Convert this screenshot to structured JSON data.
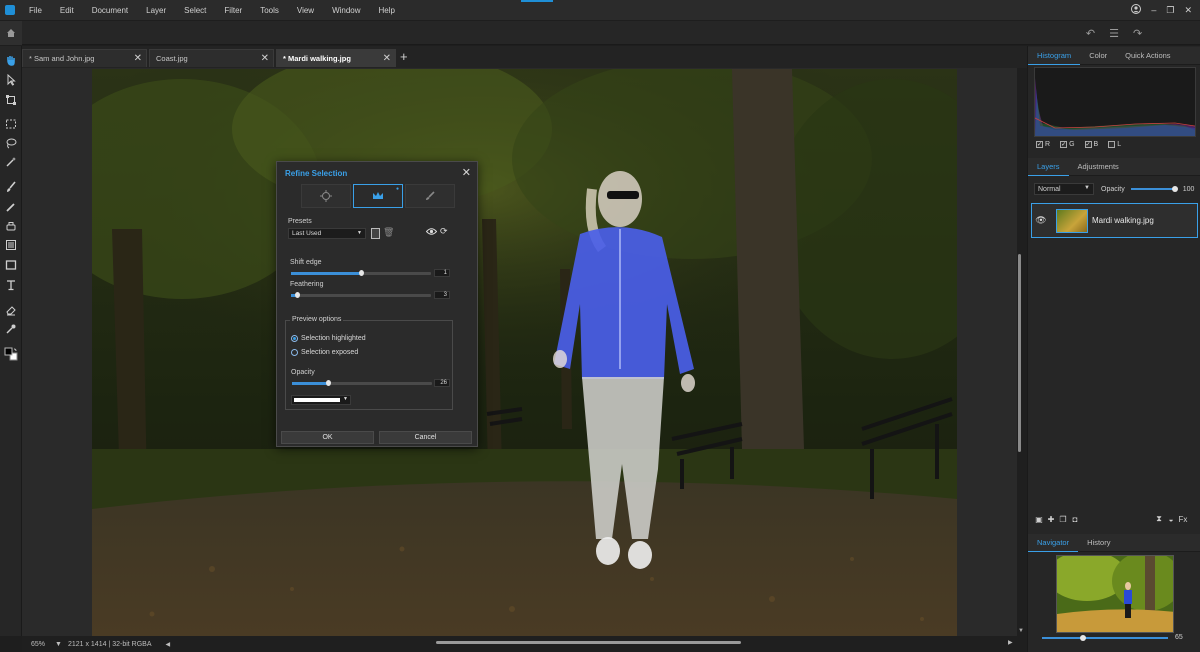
{
  "menu": [
    "File",
    "Edit",
    "Document",
    "Layer",
    "Select",
    "Filter",
    "Tools",
    "View",
    "Window",
    "Help"
  ],
  "window_controls": {
    "user_icon": "user-icon",
    "minimize": "–",
    "restore": "❐",
    "close": "✕"
  },
  "tabs": [
    {
      "label": "* Sam and John.jpg",
      "active": false
    },
    {
      "label": "Coast.jpg",
      "active": false
    },
    {
      "label": "* Mardi walking.jpg",
      "active": true
    }
  ],
  "status": {
    "zoom": "65%",
    "info": "2121 x 1414  |  32-bit RGBA"
  },
  "panels": {
    "top_tabs": [
      "Histogram",
      "Color",
      "Quick Actions"
    ],
    "histogram_channels": [
      "R",
      "G",
      "B",
      "L"
    ],
    "layer_tabs": [
      "Layers",
      "Adjustments"
    ],
    "blend_mode": "Normal",
    "opacity_label": "Opacity",
    "opacity_value": "100",
    "opacity_level": 1.0,
    "layer_name": "Mardi walking.jpg",
    "bottom_tabs": [
      "Navigator",
      "History"
    ],
    "navigator_zoom": "65"
  },
  "dialog": {
    "title": "Refine Selection",
    "presets_label": "Presets",
    "preset_value": "Last Used",
    "shift_edge_label": "Shift edge",
    "shift_edge_value": "1",
    "shift_edge_level": 0.5,
    "feathering_label": "Feathering",
    "feathering_value": "3",
    "feathering_level": 0.04,
    "preview_legend": "Preview options",
    "radio_highlighted": "Selection highlighted",
    "radio_exposed": "Selection exposed",
    "opacity_label": "Opacity",
    "opacity_value": "26",
    "opacity_level": 0.26,
    "highlight_color": "#ffffff",
    "ok_label": "OK",
    "cancel_label": "Cancel"
  },
  "colors": {
    "accent": "#3aa0e8",
    "selection_highlight": "#4a6cf0"
  }
}
